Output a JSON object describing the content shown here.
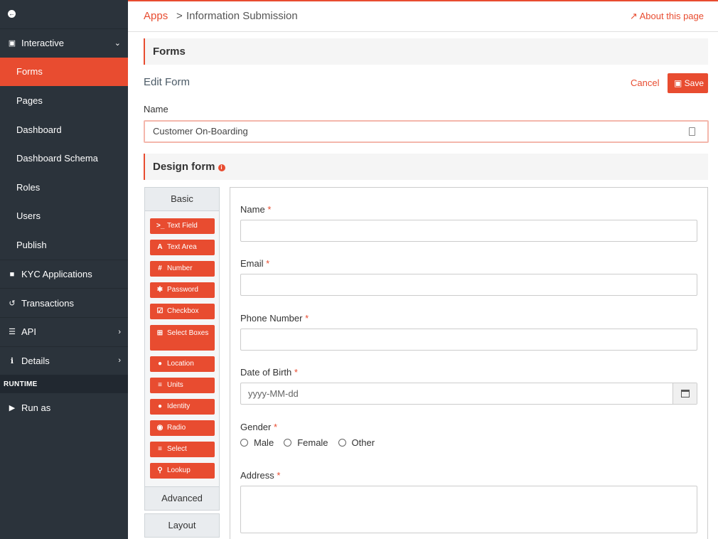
{
  "sidebar": {
    "items": [
      {
        "label": "Interactive",
        "icon": "monitor-icon"
      },
      {
        "label": "KYC Applications",
        "icon": "folder-icon"
      },
      {
        "label": "Transactions",
        "icon": "history-icon"
      },
      {
        "label": "API",
        "icon": "server-icon"
      },
      {
        "label": "Details",
        "icon": "info-icon"
      }
    ],
    "sub_items": [
      "Forms",
      "Pages",
      "Dashboard",
      "Dashboard Schema",
      "Roles",
      "Users",
      "Publish"
    ],
    "runtime_header": "RUNTIME",
    "run_as": "Run as"
  },
  "breadcrumb": {
    "apps": "Apps",
    "separator": ">",
    "current": "Information Submission",
    "about": "About this page"
  },
  "forms_panel": {
    "title": "Forms"
  },
  "edit_form": {
    "title": "Edit Form",
    "cancel": "Cancel",
    "save": "Save"
  },
  "name_field": {
    "label": "Name",
    "value": "Customer On-Boarding"
  },
  "design_panel": {
    "title": "Design form"
  },
  "builder": {
    "tabs": [
      "Basic",
      "Advanced",
      "Layout"
    ],
    "components": [
      {
        "label": "Text Field",
        "icon": "terminal-icon"
      },
      {
        "label": "Text Area",
        "icon": "font-icon"
      },
      {
        "label": "Number",
        "icon": "hashtag-icon"
      },
      {
        "label": "Password",
        "icon": "asterisk-icon"
      },
      {
        "label": "Checkbox",
        "icon": "check-square-icon"
      },
      {
        "label": "Select Boxes",
        "icon": "plus-square-icon"
      },
      {
        "label": "Location",
        "icon": "map-marker-icon"
      },
      {
        "label": "Units",
        "icon": "list-icon"
      },
      {
        "label": "Identity",
        "icon": "user-icon"
      },
      {
        "label": "Radio",
        "icon": "dot-circle-icon"
      },
      {
        "label": "Select",
        "icon": "th-list-icon"
      },
      {
        "label": "Lookup",
        "icon": "search-icon"
      }
    ]
  },
  "form": {
    "name_label": "Name",
    "email_label": "Email",
    "phone_label": "Phone Number",
    "dob_label": "Date of Birth",
    "dob_placeholder": "yyyy-MM-dd",
    "gender_label": "Gender",
    "gender_options": [
      "Male",
      "Female",
      "Other"
    ],
    "address_label": "Address",
    "required_mark": "*"
  },
  "colors": {
    "accent": "#e84c30",
    "sidebar_bg": "#2b333b"
  }
}
